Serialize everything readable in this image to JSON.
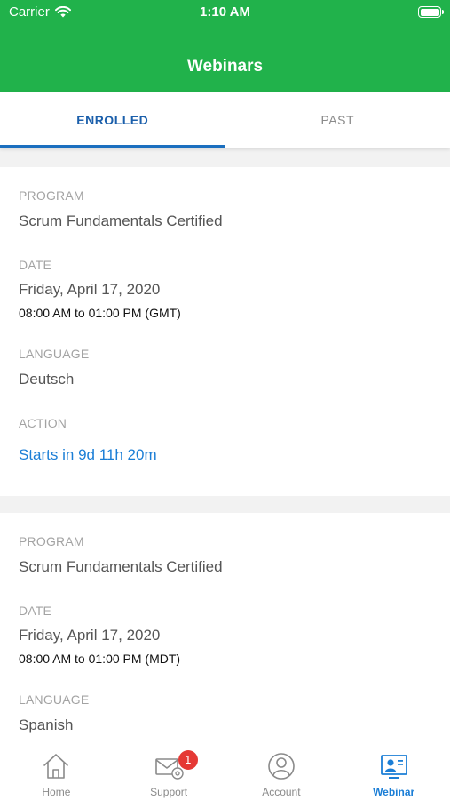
{
  "status_bar": {
    "carrier": "Carrier",
    "time": "1:10 AM"
  },
  "header": {
    "title": "Webinars"
  },
  "tabs": [
    {
      "label": "ENROLLED",
      "selected": true
    },
    {
      "label": "PAST",
      "selected": false
    }
  ],
  "webinars": [
    {
      "program_label": "PROGRAM",
      "program": "Scrum Fundamentals Certified",
      "date_label": "DATE",
      "date": "Friday, April 17, 2020",
      "time": "08:00 AM to 01:00 PM (GMT)",
      "language_label": "LANGUAGE",
      "language": "Deutsch",
      "action_label": "ACTION",
      "action": "Starts in 9d 11h 20m"
    },
    {
      "program_label": "PROGRAM",
      "program": "Scrum Fundamentals Certified",
      "date_label": "DATE",
      "date": "Friday, April 17, 2020",
      "time": "08:00 AM to 01:00 PM (MDT)",
      "language_label": "LANGUAGE",
      "language": "Spanish"
    }
  ],
  "tabbar": {
    "items": [
      {
        "label": "Home",
        "icon": "home-icon"
      },
      {
        "label": "Support",
        "icon": "mail-settings-icon",
        "badge": "1"
      },
      {
        "label": "Account",
        "icon": "user-icon"
      },
      {
        "label": "Webinar",
        "icon": "webinar-icon",
        "active": true
      }
    ]
  },
  "colors": {
    "header": "#21b24b",
    "accent": "#1b7ed6",
    "badge": "#e53935"
  }
}
